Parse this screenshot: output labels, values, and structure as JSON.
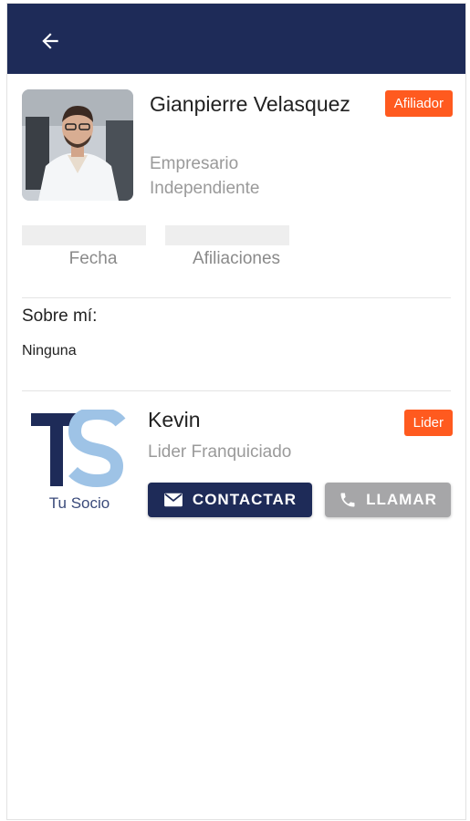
{
  "colors": {
    "appbar": "#1e2b58",
    "badge": "#ff5a1f",
    "primary_button": "#1e2b58",
    "disabled_button": "#a6a6a8",
    "muted_text": "#9a9a9a"
  },
  "appbar": {
    "back_icon": "arrow-left-icon"
  },
  "profile": {
    "name": "Gianpierre Velasquez",
    "role": "Empresario Independiente",
    "badge": "Afiliador"
  },
  "stats": {
    "fecha_label": "Fecha",
    "afiliaciones_label": "Afiliaciones"
  },
  "about": {
    "title": "Sobre mí:",
    "text": "Ninguna"
  },
  "leader": {
    "logo_text": "TS",
    "logo_caption": "Tu Socio",
    "name": "Kevin",
    "role": "Lider Franquiciado",
    "badge": "Lider",
    "contact_label": "CONTACTAR",
    "contact_icon": "mail-icon",
    "call_label": "LLAMAR",
    "call_icon": "phone-icon"
  }
}
